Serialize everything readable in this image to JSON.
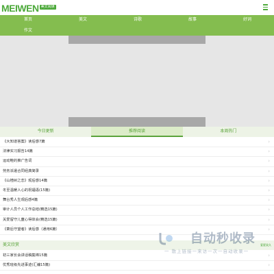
{
  "header": {
    "logo_text": "MEIWEN",
    "logo_badge": "美文阅读"
  },
  "nav": {
    "items": [
      "首页",
      "美文",
      "诗歌",
      "故事",
      "好词",
      "作文"
    ]
  },
  "tabs": [
    "今日更新",
    "推荐阅读",
    "本周热门"
  ],
  "list_items": [
    "《大知道答案》读后感7篇",
    "法律实习报告14篇",
    "运动鞋的推广告词",
    "劳务派遣合同经典简录",
    "《山楂树之恋》观后感14篇",
    "冬至温暖人心的祝福语(15篇)",
    "舞台秀人生观后感4篇",
    "审计人员个人工作总结(精选15篇)",
    "关爱留守儿童心得体会(精选15篇)",
    "《萧后守望者》读后感（通用6篇）"
  ],
  "section": {
    "title": "美文欣赏",
    "items": [
      "初三家长会讲话稿集锦15篇",
      "优秀班级先进事迹(汇编15篇)"
    ]
  },
  "watermark": {
    "title": "自动秒收录",
    "subtitle": "一 散上链接一来访一次一自动收录一",
    "small": "爱星笑久"
  },
  "colors": {
    "brand_green": "#4ca93a",
    "nav_green": "#84bd4f",
    "banner_gray": "#e6e6e6"
  }
}
